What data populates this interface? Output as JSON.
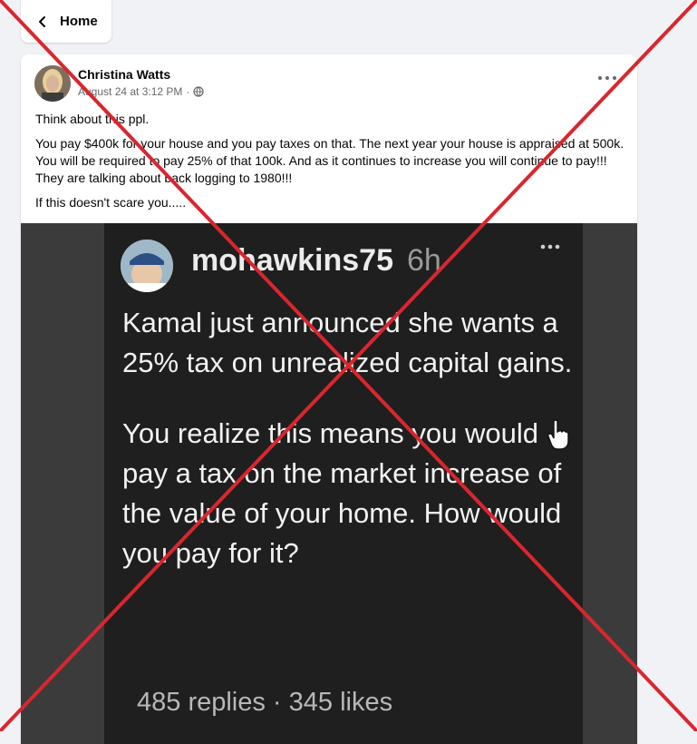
{
  "nav": {
    "home_label": "Home"
  },
  "post": {
    "author": "Christina Watts",
    "timestamp": "August 24 at 3:12 PM",
    "separator": "·",
    "paragraphs": [
      "Think about this ppl.",
      "You pay $400k for your house and you pay taxes on that. The next year your house is appraised at 500k. You will be required to pay 25% of that 100k. And as it continues to increase you will continue to pay!!! They are talking about back logging to 1980!!!",
      "If this doesn't scare you....."
    ]
  },
  "screenshot": {
    "username": "mohawkins75",
    "time": "6h",
    "body": [
      "Kamal just announced she wants a 25% tax on unrealized capital gains.",
      "You realize this means you would pay a tax on the market increase of the value of your home. How would you pay for it?"
    ],
    "stats": "485 replies · 345 likes"
  },
  "overlay": {
    "cross_color": "#d9262e"
  }
}
